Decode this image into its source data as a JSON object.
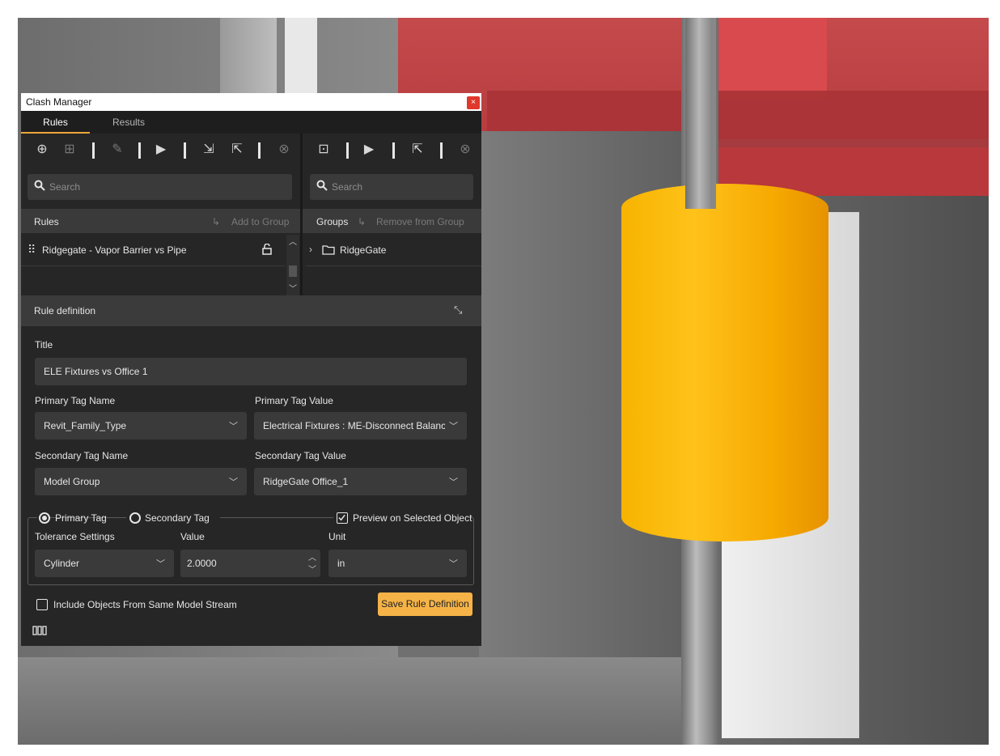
{
  "window": {
    "title": "Clash Manager",
    "close_glyph": "×"
  },
  "tabs": [
    {
      "label": "Rules"
    },
    {
      "label": "Results"
    }
  ],
  "rules_pane": {
    "search_placeholder": "Search",
    "header_label": "Rules",
    "add_to_group_label": "Add to Group",
    "items": [
      {
        "label": "Ridgegate - Vapor Barrier vs Pipe"
      }
    ]
  },
  "groups_pane": {
    "search_placeholder": "Search",
    "header_label": "Groups",
    "remove_from_group_label": "Remove from Group",
    "items": [
      {
        "label": "RidgeGate"
      }
    ]
  },
  "rule_definition": {
    "header": "Rule definition",
    "title_label": "Title",
    "title_value": "ELE Fixtures vs Office 1",
    "primary_tag_name_label": "Primary Tag Name",
    "primary_tag_name_value": "Revit_Family_Type",
    "primary_tag_value_label": "Primary Tag Value",
    "primary_tag_value_value": "Electrical Fixtures : ME-Disconnect Balanced :",
    "secondary_tag_name_label": "Secondary Tag Name",
    "secondary_tag_name_value": "Model Group",
    "secondary_tag_value_label": "Secondary Tag Value",
    "secondary_tag_value_value": "RidgeGate Office_1",
    "radio_primary_label": "Primary Tag",
    "radio_secondary_label": "Secondary Tag",
    "preview_label": "Preview on Selected Object",
    "tolerance_label": "Tolerance Settings",
    "tolerance_value": "Cylinder",
    "value_label": "Value",
    "value_value": "2.0000",
    "unit_label": "Unit",
    "unit_value": "in",
    "include_label": "Include Objects From Same Model Stream",
    "save_label": "Save Rule Definition"
  },
  "colors": {
    "accent": "#f0a63a",
    "save_button": "#f5b347",
    "panel_bg": "#262626",
    "highlight_object": "#f7b500",
    "red_volume": "#c8383a"
  }
}
